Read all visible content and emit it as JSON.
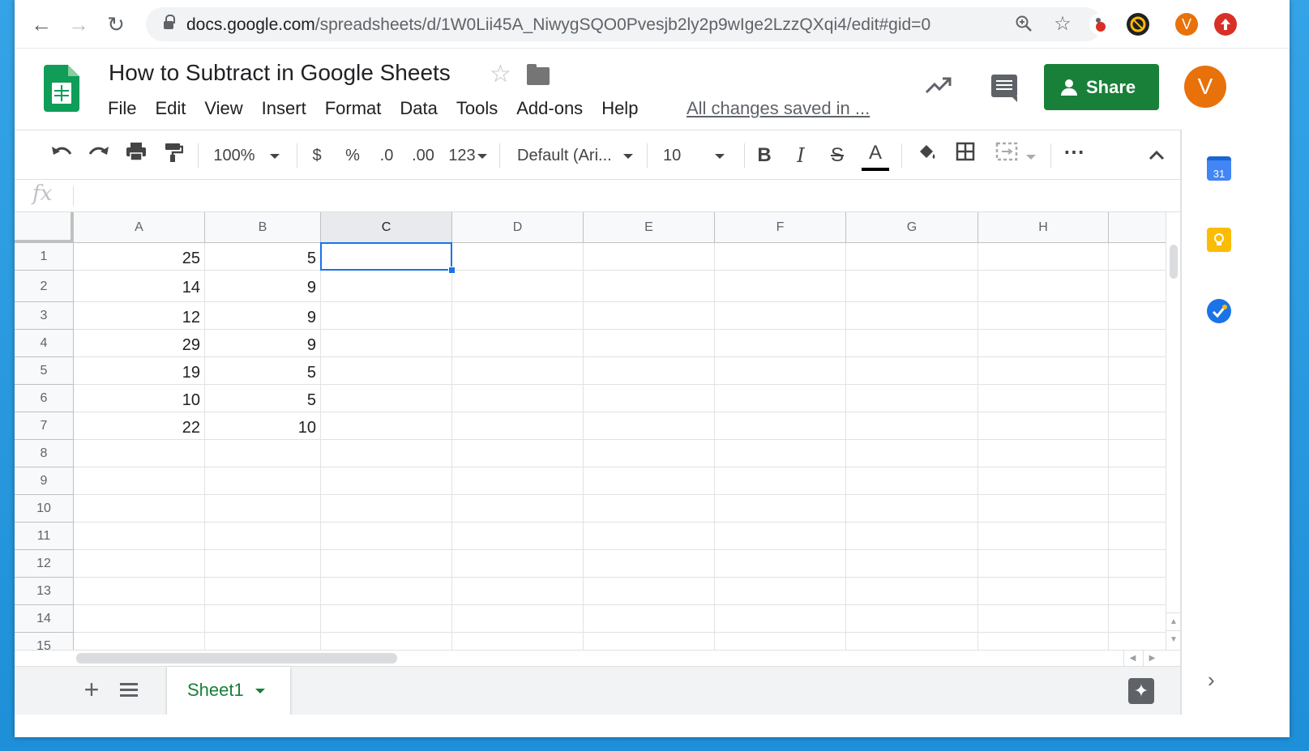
{
  "browser": {
    "url_host": "docs.google.com",
    "url_path": "/spreadsheets/d/1W0Lii45A_NiwygSQO0Pvesjb2ly2p9wIge2LzzQXqi4/edit#gid=0",
    "profile_initial": "V"
  },
  "doc": {
    "title": "How to Subtract in Google Sheets",
    "menu": [
      "File",
      "Edit",
      "View",
      "Insert",
      "Format",
      "Data",
      "Tools",
      "Add-ons",
      "Help"
    ],
    "save_status": "All changes saved in ...",
    "share_label": "Share",
    "account_initial": "V"
  },
  "toolbar": {
    "zoom": "100%",
    "currency": "$",
    "percent": "%",
    "decrease_decimal": ".0",
    "increase_decimal": ".00",
    "more_formats": "123",
    "font": "Default (Ari...",
    "font_size": "10",
    "bold": "B",
    "italic": "I",
    "strikethrough": "S",
    "text_color": "A"
  },
  "formula_bar": {
    "fx_label": "fx",
    "value": ""
  },
  "sheet": {
    "columns": [
      "A",
      "B",
      "C",
      "D",
      "E",
      "F",
      "G",
      "H"
    ],
    "selected_column": "C",
    "row_numbers": [
      "1",
      "2",
      "3",
      "4",
      "5",
      "6",
      "7",
      "8",
      "9",
      "10",
      "11",
      "12",
      "13",
      "14",
      "15"
    ],
    "cells": [
      [
        "25",
        "5"
      ],
      [
        "14",
        "9"
      ],
      [
        "12",
        "9"
      ],
      [
        "29",
        "9"
      ],
      [
        "19",
        "5"
      ],
      [
        "10",
        "5"
      ],
      [
        "22",
        "10"
      ]
    ],
    "selected_cell": "C1"
  },
  "sheet_tabs": {
    "active": "Sheet1"
  },
  "side_panel": {
    "calendar_day": "31"
  },
  "colors": {
    "sheets_green": "#0f9d58",
    "share_green": "#188038",
    "selection_blue": "#1a73e8",
    "avatar_orange": "#e8710a"
  }
}
